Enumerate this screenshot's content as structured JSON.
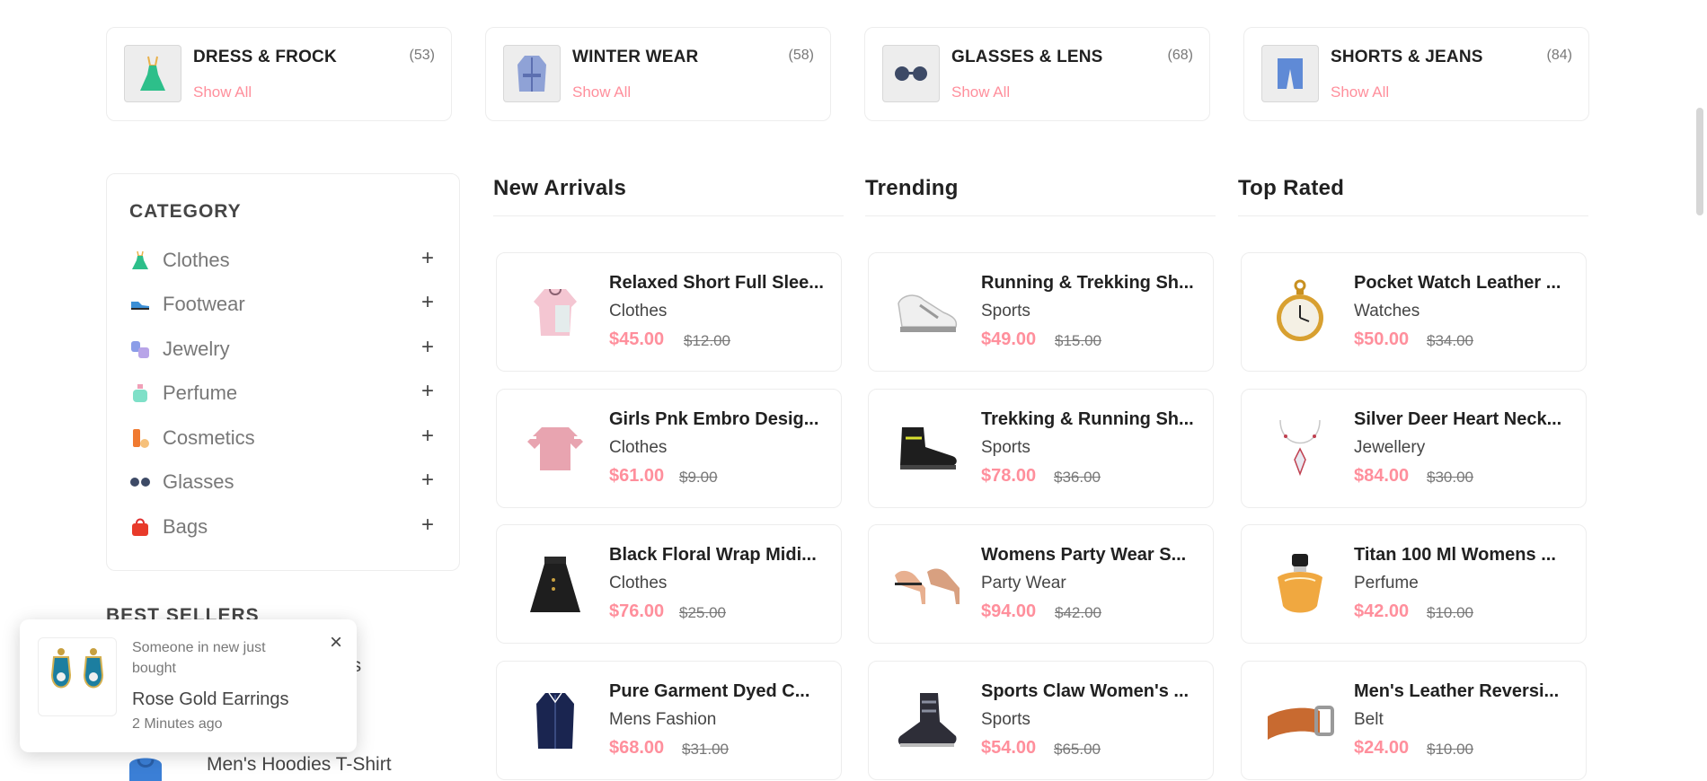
{
  "categories": [
    {
      "title": "DRESS & FROCK",
      "count": "(53)",
      "show_all": "Show All",
      "icon": "dress-icon"
    },
    {
      "title": "WINTER WEAR",
      "count": "(58)",
      "show_all": "Show All",
      "icon": "coat-icon"
    },
    {
      "title": "GLASSES & LENS",
      "count": "(68)",
      "show_all": "Show All",
      "icon": "glasses-icon"
    },
    {
      "title": "SHORTS & JEANS",
      "count": "(84)",
      "show_all": "Show All",
      "icon": "shorts-icon"
    }
  ],
  "sidebar": {
    "heading": "CATEGORY",
    "items": [
      {
        "label": "Clothes",
        "icon": "dress-icon",
        "toggle": "+"
      },
      {
        "label": "Footwear",
        "icon": "shoe-icon",
        "toggle": "+"
      },
      {
        "label": "Jewelry",
        "icon": "jewelry-icon",
        "toggle": "+"
      },
      {
        "label": "Perfume",
        "icon": "perfume-icon",
        "toggle": "+"
      },
      {
        "label": "Cosmetics",
        "icon": "cosmetics-icon",
        "toggle": "+"
      },
      {
        "label": "Glasses",
        "icon": "glasses-icon",
        "toggle": "+"
      },
      {
        "label": "Bags",
        "icon": "bag-icon",
        "toggle": "+"
      }
    ]
  },
  "best_sellers": {
    "heading": "BEST SELLERS",
    "partial_text": "es",
    "item_label": "Men's Hoodies T-Shirt"
  },
  "columns": [
    {
      "title": "New Arrivals",
      "products": [
        {
          "name": "Relaxed Short Full Slee...",
          "category": "Clothes",
          "price": "$45.00",
          "old_price": "$12.00",
          "icon": "sweater-icon"
        },
        {
          "name": "Girls Pnk Embro Desig...",
          "category": "Clothes",
          "price": "$61.00",
          "old_price": "$9.00",
          "icon": "top-icon"
        },
        {
          "name": "Black Floral Wrap Midi...",
          "category": "Clothes",
          "price": "$76.00",
          "old_price": "$25.00",
          "icon": "skirt-icon"
        },
        {
          "name": "Pure Garment Dyed C...",
          "category": "Mens Fashion",
          "price": "$68.00",
          "old_price": "$31.00",
          "icon": "jacket-icon"
        }
      ]
    },
    {
      "title": "Trending",
      "products": [
        {
          "name": "Running & Trekking Sh...",
          "category": "Sports",
          "price": "$49.00",
          "old_price": "$15.00",
          "icon": "sneaker-icon"
        },
        {
          "name": "Trekking & Running Sh...",
          "category": "Sports",
          "price": "$78.00",
          "old_price": "$36.00",
          "icon": "boot-icon"
        },
        {
          "name": "Womens Party Wear S...",
          "category": "Party Wear",
          "price": "$94.00",
          "old_price": "$42.00",
          "icon": "heels-icon"
        },
        {
          "name": "Sports Claw Women's ...",
          "category": "Sports",
          "price": "$54.00",
          "old_price": "$65.00",
          "icon": "sport-shoe-icon"
        }
      ]
    },
    {
      "title": "Top Rated",
      "products": [
        {
          "name": "Pocket Watch Leather ...",
          "category": "Watches",
          "price": "$50.00",
          "old_price": "$34.00",
          "icon": "watch-icon"
        },
        {
          "name": "Silver Deer Heart Neck...",
          "category": "Jewellery",
          "price": "$84.00",
          "old_price": "$30.00",
          "icon": "necklace-icon"
        },
        {
          "name": "Titan 100 Ml Womens ...",
          "category": "Perfume",
          "price": "$42.00",
          "old_price": "$10.00",
          "icon": "perfume-icon"
        },
        {
          "name": "Men's Leather Reversi...",
          "category": "Belt",
          "price": "$24.00",
          "old_price": "$10.00",
          "icon": "belt-icon"
        }
      ]
    }
  ],
  "toast": {
    "message": "Someone in new just bought",
    "product": "Rose Gold Earrings",
    "time": "2 Minutes ago",
    "close": "×",
    "icon": "earrings-icon"
  },
  "colors": {
    "accent": "#ff8f9c",
    "border": "#ededed",
    "text": "#212121",
    "muted": "#787878"
  }
}
